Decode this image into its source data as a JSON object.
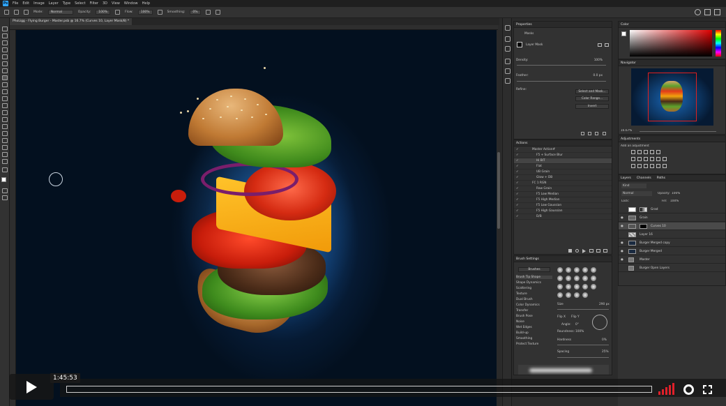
{
  "menu": [
    "File",
    "Edit",
    "Image",
    "Layer",
    "Type",
    "Select",
    "Filter",
    "3D",
    "View",
    "Window",
    "Help"
  ],
  "options": {
    "mode_label": "Mode:",
    "mode_value": "Normal",
    "opacity_label": "Opacity:",
    "opacity_value": "100%",
    "flow_label": "Flow:",
    "flow_value": "100%",
    "smoothing_label": "Smoothing:",
    "smoothing_value": "0%"
  },
  "document_tab": "PhoLigg - Flying Burger - Master.psb @ 16.7% (Curves 10, Layer Mask/8) *",
  "properties": {
    "title": "Properties",
    "masks_label": "Masks",
    "layer_mask_label": "Layer Mask",
    "density_label": "Density:",
    "density_value": "100%",
    "feather_label": "Feather:",
    "feather_value": "0.0 px",
    "refine_label": "Refine:",
    "select_mask_button": "Select and Mask...",
    "color_range_button": "Color Range...",
    "invert_button": "Invert"
  },
  "actions": {
    "title": "Actions",
    "items": [
      "Master Action#",
      "F5 + Surface Blur",
      "Hi BIT",
      "Flat",
      "UB Grain",
      "Glow + DB",
      "FC 1 RGN",
      "Raw Grain",
      "F5 Low Median",
      "F5 High Median",
      "F5 Low Gaussian",
      "F5 High Gaussian",
      "D/B"
    ]
  },
  "brush_settings": {
    "title": "Brush Settings",
    "brushes_button": "Brushes",
    "options": [
      "Brush Tip Shape",
      "Shape Dynamics",
      "Scattering",
      "Texture",
      "Dual Brush",
      "Color Dynamics",
      "Transfer",
      "Brush Pose",
      "Noise",
      "Wet Edges",
      "Build-up",
      "Smoothing",
      "Protect Texture"
    ],
    "size_label": "Size",
    "size_value": "290 px",
    "flip_x": "Flip X",
    "flip_y": "Flip Y",
    "angle_label": "Angle:",
    "angle_value": "0°",
    "roundness_label": "Roundness:",
    "roundness_value": "100%",
    "hardness_label": "Hardness",
    "hardness_value": "0%",
    "spacing_label": "Spacing",
    "spacing_value": "25%"
  },
  "color_panel": {
    "title": "Color"
  },
  "navigator": {
    "title": "Navigator",
    "zoom": "16.67%"
  },
  "adjustments": {
    "title": "Adjustments",
    "subtitle": "Add an adjustment"
  },
  "layers": {
    "tabs": [
      "Layers",
      "Channels",
      "Paths"
    ],
    "kind_label": "Kind",
    "blend_mode": "Normal",
    "opacity_label": "Opacity:",
    "opacity_value": "100%",
    "lock_label": "Lock:",
    "fill_label": "Fill:",
    "fill_value": "100%",
    "items": [
      "Grad",
      "Grain",
      "Curves 10",
      "Layer 16",
      "Burger Merged copy",
      "Burger Merged",
      "Master",
      "Burger Open Layers"
    ]
  },
  "video": {
    "time": "1:45:53"
  }
}
